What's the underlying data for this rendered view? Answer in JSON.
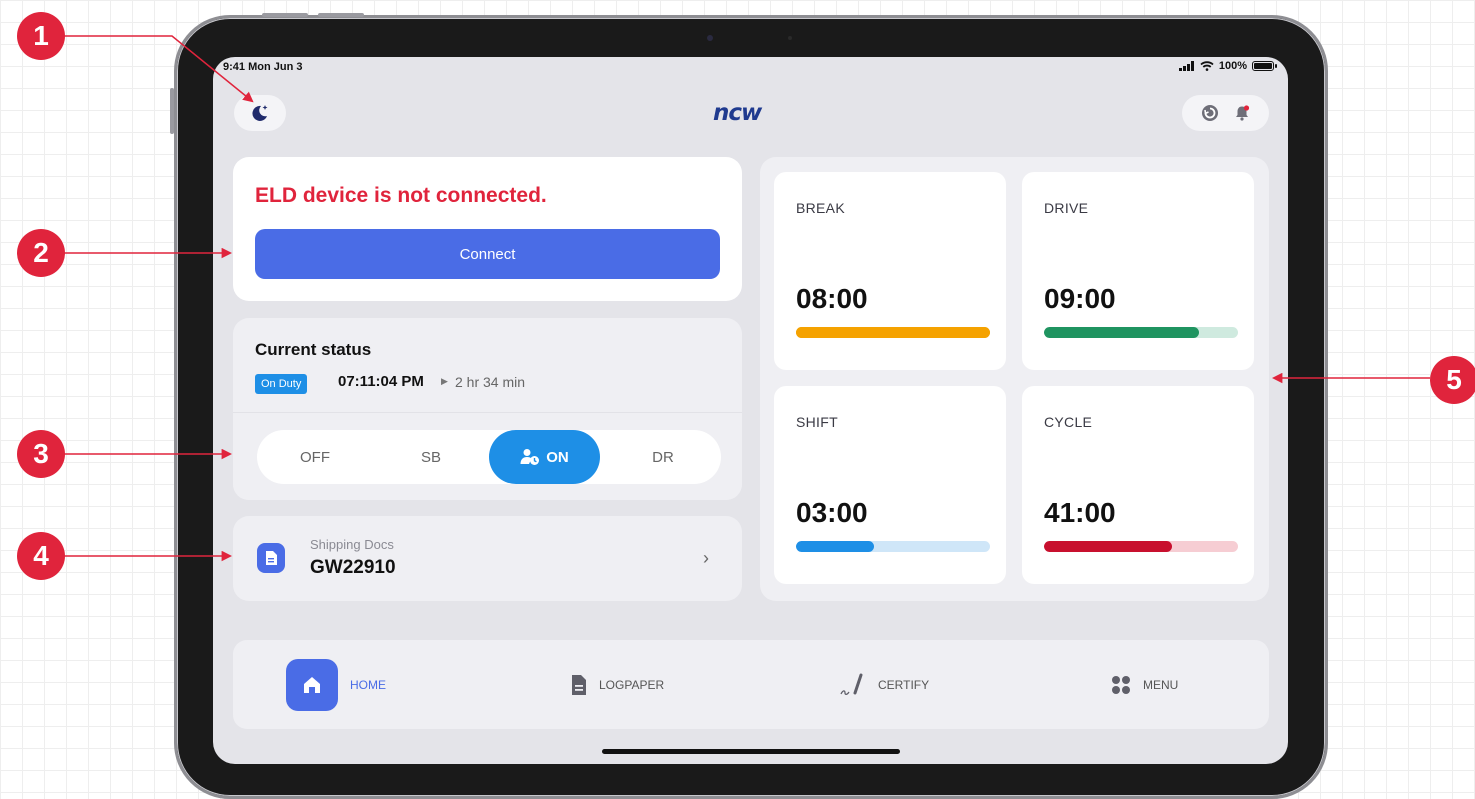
{
  "status_bar": {
    "time": "9:41 Mon Jun 3",
    "battery": "100%"
  },
  "header": {
    "logo": "ncw",
    "night_mode_icon": "moon-stars-icon",
    "sync_icon": "sync-icon",
    "bell_icon": "bell-icon"
  },
  "eld": {
    "message": "ELD device is not connected.",
    "connect_label": "Connect"
  },
  "current_status": {
    "title": "Current status",
    "badge": "On Duty",
    "time": "07:11:04 PM",
    "duration": "2 hr 34 min"
  },
  "duty_options": {
    "off": "OFF",
    "sb": "SB",
    "on": "ON",
    "dr": "DR"
  },
  "shipping": {
    "label": "Shipping Docs",
    "value": "GW22910"
  },
  "timers": [
    {
      "label": "BREAK",
      "value": "08:00",
      "progress": 1.0,
      "color": "#f5a200",
      "track": "#f5a200"
    },
    {
      "label": "DRIVE",
      "value": "09:00",
      "progress": 0.8,
      "color": "#1f9460",
      "track": "#cfeadf"
    },
    {
      "label": "SHIFT",
      "value": "03:00",
      "progress": 0.4,
      "color": "#1e8fe6",
      "track": "#cfe6f8"
    },
    {
      "label": "CYCLE",
      "value": "41:00",
      "progress": 0.66,
      "color": "#c8102e",
      "track": "#f6cdd3"
    }
  ],
  "tabs": {
    "home": "HOME",
    "logpaper": "LOGPAPER",
    "certify": "CERTIFY",
    "menu": "MENU"
  },
  "callouts": [
    "1",
    "2",
    "3",
    "4",
    "5"
  ],
  "colors": {
    "accent": "#4a6ce6",
    "alert": "#e0243c",
    "on_duty": "#1e8fe6",
    "callout": "#e0243c"
  }
}
